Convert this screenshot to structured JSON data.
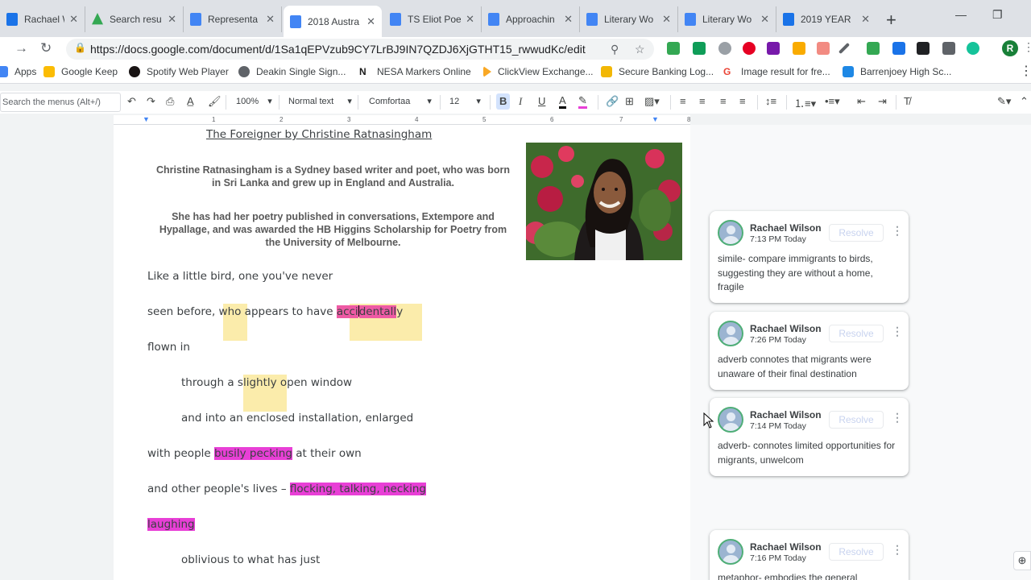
{
  "tabs": [
    {
      "label": "Rachael Wi",
      "color": "#1a73e8",
      "active": false
    },
    {
      "label": "Search resu",
      "color": "#34a853",
      "active": false
    },
    {
      "label": "Representa",
      "color": "#4285f4",
      "active": false
    },
    {
      "label": "2018 Austra",
      "color": "#4285f4",
      "active": true
    },
    {
      "label": "TS Eliot Poe",
      "color": "#4285f4",
      "active": false
    },
    {
      "label": "Approachin",
      "color": "#4285f4",
      "active": false
    },
    {
      "label": "Literary Wo",
      "color": "#4285f4",
      "active": false
    },
    {
      "label": "Literary Wo",
      "color": "#4285f4",
      "active": false
    },
    {
      "label": "2019 YEAR",
      "color": "#1a73e8",
      "active": false
    }
  ],
  "browser": {
    "url": "https://docs.google.com/document/d/1Sa1qEPVzub9CY7LrBJ9IN7QZDJ6XjGTHT15_rwwudKc/edit",
    "profile_initial": "R",
    "new_tab": "+"
  },
  "bookmarks": [
    {
      "label": "Apps",
      "color": "#4285f4"
    },
    {
      "label": "Google Keep",
      "color": "#fbbc04"
    },
    {
      "label": "Spotify Web Player",
      "color": "#191414"
    },
    {
      "label": "Deakin Single Sign...",
      "color": "#5f6368"
    },
    {
      "label": "NESA Markers Online",
      "color": "#1a1a1a"
    },
    {
      "label": "ClickView Exchange...",
      "color": "#f9a825"
    },
    {
      "label": "Secure Banking Log...",
      "color": "#f2b705"
    },
    {
      "label": "Image result for fre...",
      "color": "#ea4335"
    },
    {
      "label": "Barrenjoey High Sc...",
      "color": "#1e88e5"
    }
  ],
  "toolbar": {
    "menu_search_placeholder": "Search the menus (Alt+/)",
    "zoom": "100%",
    "style": "Normal text",
    "font": "Comfortaa",
    "font_size": "12",
    "bold": "B",
    "italic": "I",
    "underline": "U",
    "text_color": "A"
  },
  "ruler": [
    "1",
    "2",
    "3",
    "4",
    "5",
    "6",
    "7",
    "8"
  ],
  "document": {
    "title": "The Foreigner by Christine  Ratnasingham",
    "bio1_line1": "Christine Ratnasingham is a Sydney based writer and poet, who was born",
    "bio1_line2": "in Sri Lanka and grew up in England and Australia.",
    "bio2_line1": "She has had her poetry published in conversations, Extempore and",
    "bio2_line2": "Hypallage, and was awarded the HB Higgins Scholarship for Poetry from",
    "bio2_line3": "the University of Melbourne.",
    "poem": {
      "l1": "Like a little bird, one you've never",
      "l2_a": "seen before, ",
      "l2_b": "who",
      "l2_c": " appears to have ",
      "l2_d": "acci",
      "l2_e": "dentall",
      "l2_f": "y",
      "l3": "flown in",
      "l4_a": "through a ",
      "l4_b": "slightly",
      "l4_c": " open window",
      "l5": "and into an enclosed installation, enlarged",
      "l6_a": "with people ",
      "l6_b": "busily pecking",
      "l6_c": " at their own",
      "l7_a": "and other people's lives – ",
      "l7_b": "flocking, talking, necking",
      "l8": "laughing",
      "l9": "oblivious to what has just"
    }
  },
  "comments": [
    {
      "author": "Rachael Wilson",
      "time": "7:13 PM Today",
      "resolve": "Resolve",
      "text": "simile- compare immigrants to birds, suggesting they are without a home, fragile"
    },
    {
      "author": "Rachael Wilson",
      "time": "7:26 PM Today",
      "resolve": "Resolve",
      "text": "adverb connotes that migrants were unaware of their final destination"
    },
    {
      "author": "Rachael Wilson",
      "time": "7:14 PM Today",
      "resolve": "Resolve",
      "text": "adverb- connotes limited opportunities for migrants, unwelcom"
    },
    {
      "author": "Rachael Wilson",
      "time": "7:16 PM Today",
      "resolve": "Resolve",
      "text": "metaphor- embodies the general"
    }
  ],
  "colors": {
    "highlight_yellow": "#fef2b8",
    "highlight_magenta": "#e83fd6",
    "highlight_pink": "#ee5aa4",
    "docs_blue": "#4285f4",
    "avatar_ring": "#4fae77"
  }
}
